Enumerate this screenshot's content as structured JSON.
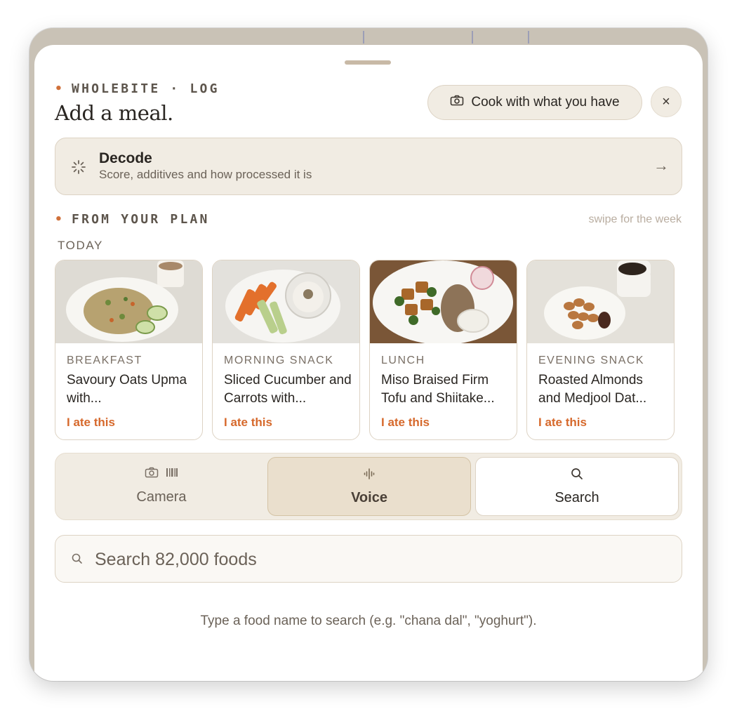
{
  "header": {
    "eyebrow": "WHOLEBITE · LOG",
    "title": "Add a meal.",
    "cook_button": "Cook with what you have",
    "close_icon": "×"
  },
  "decode": {
    "title": "Decode",
    "subtitle": "Score, additives and how processed it is",
    "arrow": "→"
  },
  "plan": {
    "section_label": "FROM YOUR PLAN",
    "swipe_hint": "swipe for the week",
    "day_label": "TODAY",
    "cards": [
      {
        "meal": "BREAKFAST",
        "name": "Savoury Oats Upma with...",
        "action": "I ate this"
      },
      {
        "meal": "MORNING SNACK",
        "name": "Sliced Cucumber and Carrots with...",
        "action": "I ate this"
      },
      {
        "meal": "LUNCH",
        "name": "Miso Braised Firm Tofu and Shiitake...",
        "action": "I ate this"
      },
      {
        "meal": "EVENING SNACK",
        "name": "Roasted Almonds and Medjool Dat...",
        "action": "I ate this"
      }
    ]
  },
  "modes": {
    "camera": "Camera",
    "voice": "Voice",
    "search": "Search",
    "selected": "Voice"
  },
  "search": {
    "placeholder": "Search 82,000 foods",
    "value": ""
  },
  "hint": "Type a food name to search (e.g. \"chana dal\", \"yoghurt\").",
  "colors": {
    "accent": "#d6692c",
    "panel": "#f1ece3",
    "border": "#ddd3c4"
  },
  "icons": [
    "camera-icon",
    "close-icon",
    "loading-spinner-icon",
    "arrow-right-icon",
    "barcode-icon",
    "microphone-icon",
    "search-icon"
  ]
}
